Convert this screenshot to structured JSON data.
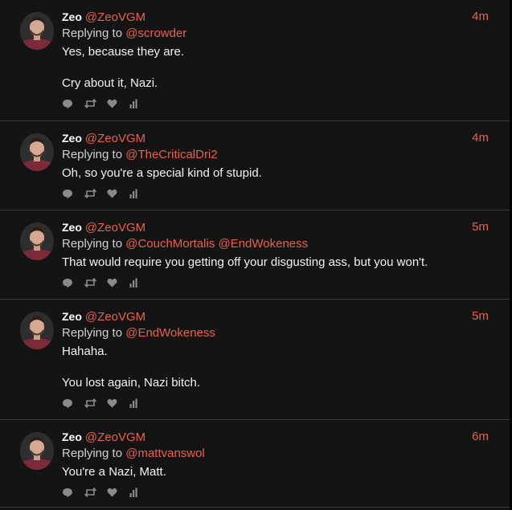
{
  "colors": {
    "background": "#141414",
    "divider": "#3a3a3a",
    "accent": "#e8604c",
    "name": "#ffffff",
    "body_text": "#f2f2f2",
    "secondary_text": "#d0d0d0",
    "action_icon": "#8a8a8a"
  },
  "reply_prefix": "Replying to",
  "actions": [
    "reply-icon",
    "retweet-icon",
    "like-icon",
    "analytics-icon"
  ],
  "tweets": [
    {
      "name": "Zeo",
      "handle": "@ZeoVGM",
      "time": "4m",
      "reply_to": "@scrowder",
      "paragraphs": [
        "Yes, because they are.",
        "Cry about it, Nazi."
      ]
    },
    {
      "name": "Zeo",
      "handle": "@ZeoVGM",
      "time": "4m",
      "reply_to": "@TheCriticalDri2",
      "paragraphs": [
        "Oh, so you're a special kind of stupid."
      ]
    },
    {
      "name": "Zeo",
      "handle": "@ZeoVGM",
      "time": "5m",
      "reply_to": "@CouchMortalis @EndWokeness",
      "paragraphs": [
        "That would require you getting off your disgusting ass, but you won't."
      ]
    },
    {
      "name": "Zeo",
      "handle": "@ZeoVGM",
      "time": "5m",
      "reply_to": "@EndWokeness",
      "paragraphs": [
        "Hahaha.",
        "You lost again, Nazi bitch."
      ]
    },
    {
      "name": "Zeo",
      "handle": "@ZeoVGM",
      "time": "6m",
      "reply_to": "@mattvanswol",
      "paragraphs": [
        "You're a Nazi, Matt."
      ]
    }
  ]
}
